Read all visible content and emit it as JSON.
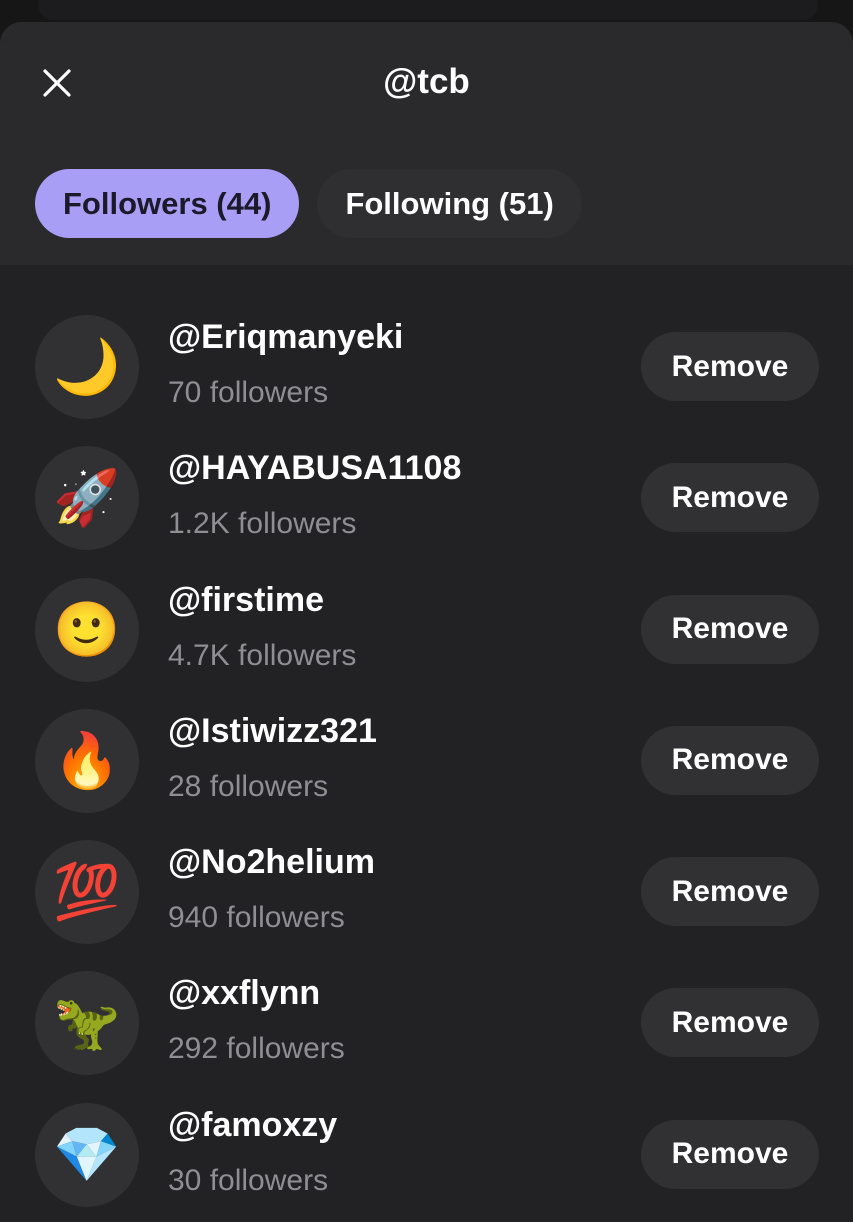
{
  "header": {
    "title": "@tcb",
    "close_icon": "close-icon"
  },
  "tabs": [
    {
      "label": "Followers (44)",
      "active": true
    },
    {
      "label": "Following (51)",
      "active": false
    }
  ],
  "colors": {
    "accent": "#a99ef6",
    "sheet": "#222224",
    "header": "#2a2a2c",
    "muted_text": "#8e8e93"
  },
  "users": [
    {
      "avatar": "🌙",
      "avatar_icon": "crescent-moon-emoji",
      "username": "@Eriqmanyeki",
      "followers": "70 followers",
      "action": "Remove"
    },
    {
      "avatar": "🚀",
      "avatar_icon": "rocket-emoji",
      "username": "@HAYABUSA1108",
      "followers": "1.2K followers",
      "action": "Remove"
    },
    {
      "avatar": "🙂",
      "avatar_icon": "slightly-smiling-face-emoji",
      "username": "@firstime",
      "followers": "4.7K followers",
      "action": "Remove"
    },
    {
      "avatar": "🔥",
      "avatar_icon": "fire-emoji",
      "username": "@Istiwizz321",
      "followers": "28 followers",
      "action": "Remove"
    },
    {
      "avatar": "💯",
      "avatar_icon": "hundred-points-emoji",
      "username": "@No2helium",
      "followers": "940 followers",
      "action": "Remove"
    },
    {
      "avatar": "🦖",
      "avatar_icon": "t-rex-emoji",
      "username": "@xxflynn",
      "followers": "292 followers",
      "action": "Remove"
    },
    {
      "avatar": "💎",
      "avatar_icon": "gem-stone-emoji",
      "username": "@famoxzy",
      "followers": "30 followers",
      "action": "Remove"
    }
  ]
}
